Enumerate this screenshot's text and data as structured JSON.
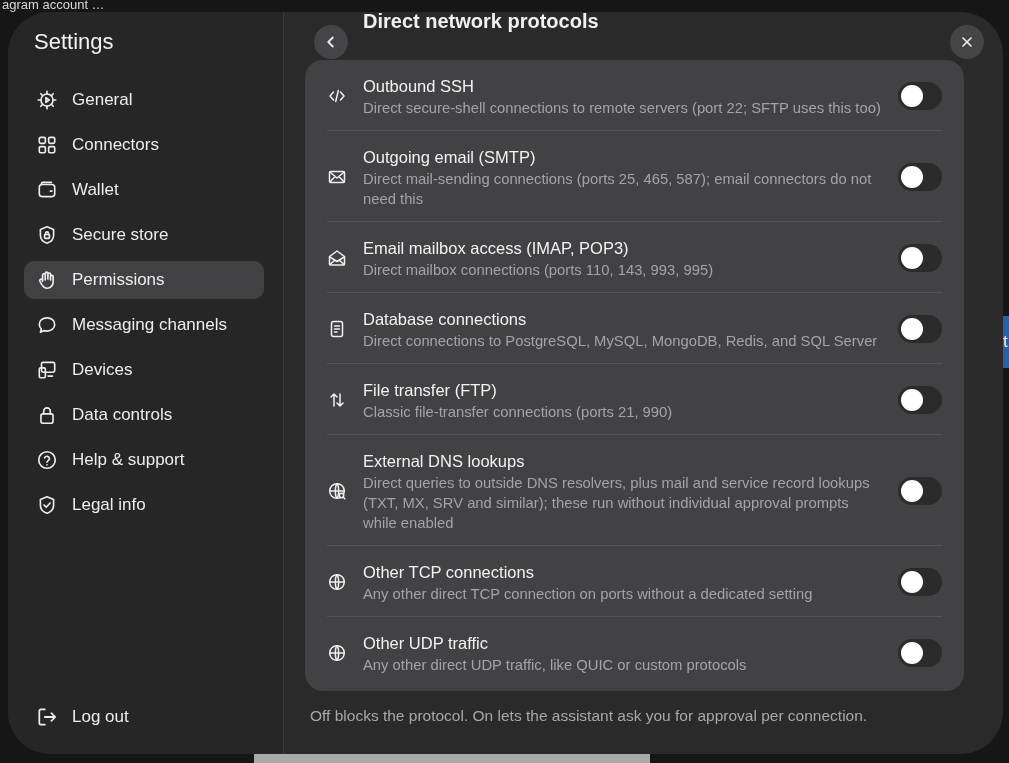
{
  "background": {
    "title_fragment": "agram account …",
    "button_fragment": "t"
  },
  "settings": {
    "title": "Settings",
    "nav": [
      {
        "label": "General",
        "selected": false
      },
      {
        "label": "Connectors",
        "selected": false
      },
      {
        "label": "Wallet",
        "selected": false
      },
      {
        "label": "Secure store",
        "selected": false
      },
      {
        "label": "Permissions",
        "selected": true
      },
      {
        "label": "Messaging channels",
        "selected": false
      },
      {
        "label": "Devices",
        "selected": false
      },
      {
        "label": "Data controls",
        "selected": false
      },
      {
        "label": "Help & support",
        "selected": false
      },
      {
        "label": "Legal info",
        "selected": false
      }
    ],
    "logout": "Log out"
  },
  "panel": {
    "heading": "Direct network protocols",
    "protocols": [
      {
        "title": "Outbound SSH",
        "description": "Direct secure-shell connections to remote servers (port 22; SFTP uses this too)",
        "on": false
      },
      {
        "title": "Outgoing email (SMTP)",
        "description": "Direct mail-sending connections (ports 25, 465, 587); email connectors do not need this",
        "on": false
      },
      {
        "title": "Email mailbox access (IMAP, POP3)",
        "description": "Direct mailbox connections (ports 110, 143, 993, 995)",
        "on": false
      },
      {
        "title": "Database connections",
        "description": "Direct connections to PostgreSQL, MySQL, MongoDB, Redis, and SQL Server",
        "on": false
      },
      {
        "title": "File transfer (FTP)",
        "description": "Classic file-transfer connections (ports 21, 990)",
        "on": false
      },
      {
        "title": "External DNS lookups",
        "description": "Direct queries to outside DNS resolvers, plus mail and service record lookups (TXT, MX, SRV and similar); these run without individual approval prompts while enabled",
        "on": false
      },
      {
        "title": "Other TCP connections",
        "description": "Any other direct TCP connection on ports without a dedicated setting",
        "on": false
      },
      {
        "title": "Other UDP traffic",
        "description": "Any other direct UDP traffic, like QUIC or custom protocols",
        "on": false
      }
    ],
    "footnote": "Off blocks the protocol. On lets the assistant ask you for approval per connection."
  }
}
